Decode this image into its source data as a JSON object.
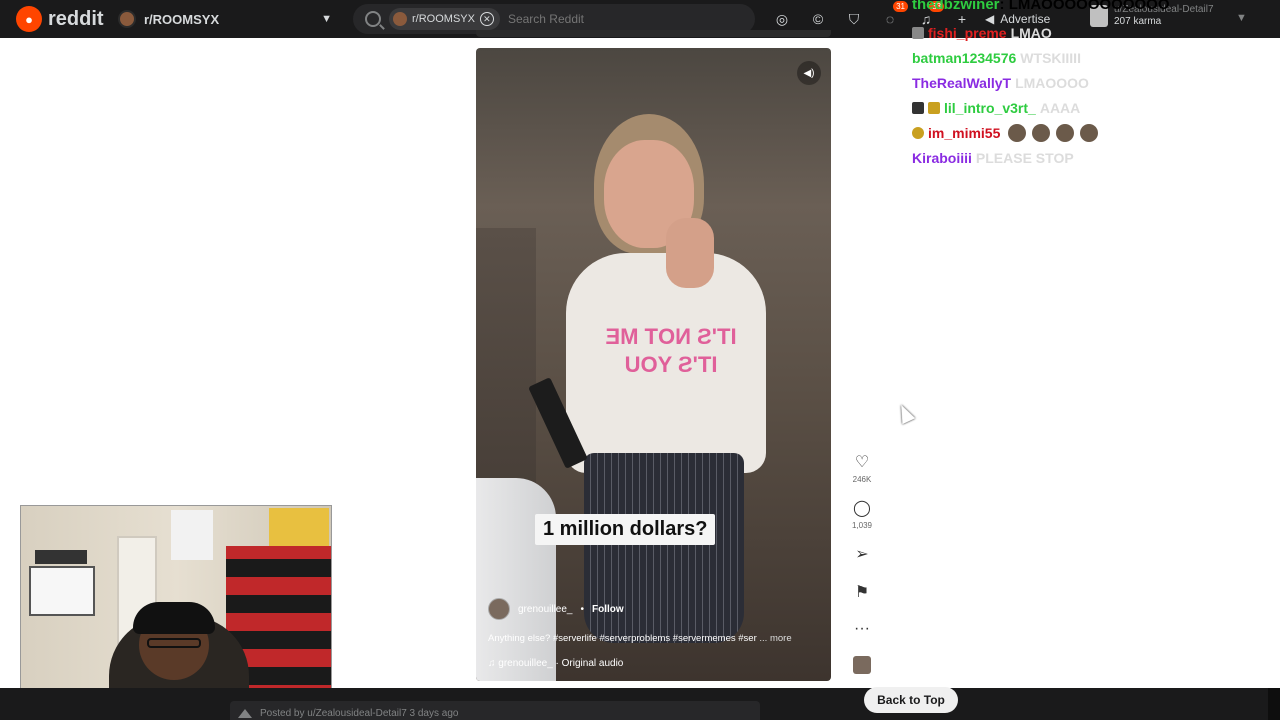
{
  "topbar": {
    "logo_text": "reddit",
    "subreddit": "r/ROOMSYX",
    "search_chip": "r/ROOMSYX",
    "search_placeholder": "Search Reddit",
    "chat_badge": "31",
    "notif_badge": "33",
    "advertise": "Advertise",
    "username": "u/Zealousideal-Detail7",
    "karma": "207 karma"
  },
  "chat": {
    "first": {
      "user": "thedbzwiner",
      "msg": "LMAOOOOOOOOOOO"
    },
    "lines": [
      {
        "user": "fishi_preme",
        "msg": "LMAO",
        "color": "#e02020"
      },
      {
        "user": "batman1234576",
        "msg": "WTSKIIIII",
        "color": "#2ecc40"
      },
      {
        "user": "TheRealWallyT",
        "msg": "LMAOOOO",
        "color": "#8a2be2"
      },
      {
        "user": "lil_intro_v3rt_",
        "msg": "AAAA",
        "color": "#2ecc40"
      },
      {
        "user": "im_mimi55",
        "msg": "",
        "color": "#d01020"
      },
      {
        "user": "Kiraboiiii",
        "msg": "PLEASE STOP",
        "color": "#8a2be2"
      }
    ]
  },
  "video": {
    "caption": "1 million dollars?",
    "shirt_text": "IT'S NOT ME IT'S YOU",
    "creator": "grenouillee_",
    "follow": "Follow",
    "description": "Anything else? #serverlife #serverproblems #servermemes #ser",
    "more": "... more",
    "audio": "grenouillee_ · Original audio"
  },
  "rail": {
    "likes": "246K",
    "comments": "1,039"
  },
  "bottom": {
    "posted_by": "Posted by u/Zealousideal-Detail7 3 days ago",
    "back_to_top": "Back to Top"
  }
}
